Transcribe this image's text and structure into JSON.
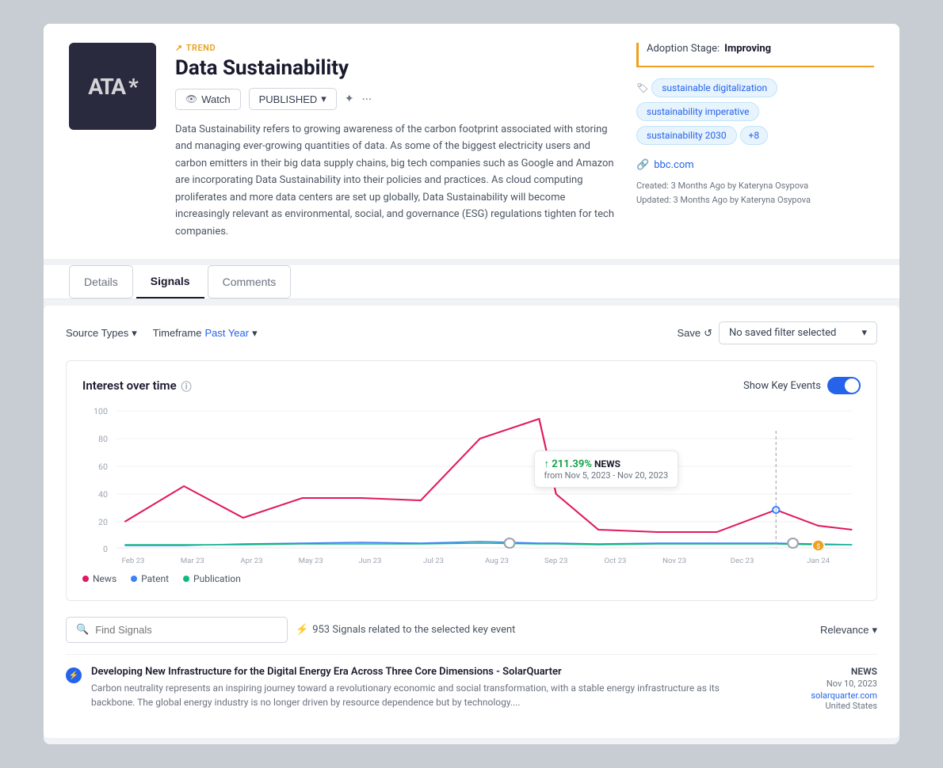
{
  "page": {
    "background": "#c8cdd4"
  },
  "header": {
    "trend_label": "TREND",
    "title": "Data Sustainability",
    "watch_button": "Watch",
    "status_button": "PUBLISHED",
    "adoption_label": "Adoption Stage:",
    "adoption_value": "Improving"
  },
  "tags": [
    "sustainable digitalization",
    "sustainability imperative",
    "sustainability 2030"
  ],
  "tag_more": "+8",
  "source_link": "bbc.com",
  "meta": {
    "created": "Created: 3 Months Ago by Kateryna Osypova",
    "updated": "Updated: 3 Months Ago by Kateryna Osypova"
  },
  "description": "Data Sustainability refers to growing awareness of the carbon footprint associated with storing and managing ever-growing quantities of data. As some of the biggest electricity users and carbon emitters in their big data supply chains, big tech companies such as Google and Amazon are incorporating Data Sustainability into their policies and practices. As cloud computing proliferates and more data centers are set up globally, Data Sustainability will become increasingly relevant as environmental, social, and governance (ESG) regulations tighten for tech companies.",
  "tabs": {
    "details": "Details",
    "signals": "Signals",
    "comments": "Comments"
  },
  "filters": {
    "source_types_label": "Source Types",
    "timeframe_label": "Timeframe",
    "timeframe_value": "Past Year",
    "save_label": "Save",
    "filter_select_label": "No saved filter selected",
    "selected_label": "selected"
  },
  "chart": {
    "title": "Interest over time",
    "show_key_events": "Show Key Events",
    "tooltip": {
      "percent": "↑ 211.39%",
      "type": "NEWS",
      "from_label": "from",
      "date_range": "Nov 5, 2023 - Nov 20, 2023"
    },
    "x_axis": [
      "Feb 23",
      "Mar 23",
      "Apr 23",
      "May 23",
      "Jun 23",
      "Jul 23",
      "Aug 23",
      "Sep 23",
      "Oct 23",
      "Nov 23",
      "Dec 23",
      "Jan 24"
    ],
    "y_axis": [
      0,
      20,
      40,
      60,
      80,
      100
    ],
    "legend": [
      {
        "label": "News",
        "color": "#e0185e"
      },
      {
        "label": "Patent",
        "color": "#3b82f6"
      },
      {
        "label": "Publication",
        "color": "#10b981"
      }
    ]
  },
  "search": {
    "placeholder": "Find Signals",
    "count_text": "953 Signals related to the selected key event",
    "relevance_label": "Relevance"
  },
  "signal_item": {
    "title": "Developing New Infrastructure for the Digital Energy Era Across Three Core Dimensions - SolarQuarter",
    "description": "Carbon neutrality represents an inspiring journey toward a revolutionary economic and social transformation, with a stable energy infrastructure as its backbone. The global energy industry is no longer driven by resource dependence but by technology....",
    "source_type": "NEWS",
    "date": "Nov 10, 2023",
    "origin": "solarquarter.com",
    "country": "United States"
  }
}
